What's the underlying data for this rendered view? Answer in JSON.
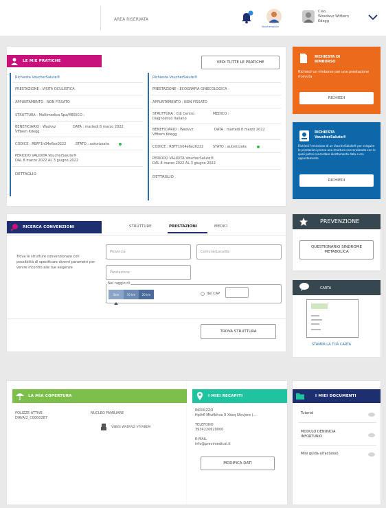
{
  "header": {
    "area_label": "AREA RISERVATA",
    "avatar_caption": "Vouchersalute",
    "user_greeting": "Ciao,",
    "user_name_line1": "Wzadwvz Wtfbem",
    "user_name_line2": "Kdegg"
  },
  "pratiche": {
    "tag": "LE MIE PRATICHE",
    "view_all": "VEDI TUTTE LE PRATICHE",
    "left": {
      "title": "Richiesta VoucherSalute®",
      "prestazione": "PRESTAZIONE : VISITA OCULISTICA",
      "appuntamento": "APPUNTAMENTO : NON FISSATO",
      "struttura": "STRUTTURA : Multimedica Spa/MEDICO :",
      "beneficiario": "BENEFICIARIO : Wadvvz",
      "beneficiario2": "Vffbem Kdegg",
      "data": "DATA : martedì 8 marzo 2022",
      "codice": "CODICE : RBFF1h04e6ez0222",
      "stato": "STATO : autorizzata",
      "periodo1": "PERIODO VALIDITA VoucherSalute®",
      "periodo2": "DAL 8 marzo 2022 AL 3 giugno 2022",
      "dettaglio": "DETTAGLIO"
    },
    "right": {
      "title": "Richiesta VoucherSalute®",
      "prestazione": "PRESTAZIONE : ECOGRAFIA GINECOLOGICA",
      "appuntamento": "APPUNTAMENTO : NON FISSATO",
      "struttura1": "STRUTTURA : Cdi Centro",
      "struttura2": "Diagnostico Italiano",
      "medico": "MEDICO :",
      "beneficiario": "BENEFICIARIO : Wadvvz",
      "beneficiario2": "Vffbem Kdegg",
      "data": "DATA : martedì 8 marzo 2022",
      "codice": "CODICE : RBFF1h04e6ez0222",
      "stato": "STATO : autorizzata",
      "periodo1": "PERIODO VALIDITA VoucherSalute®",
      "periodo2": "DAL 8 marzo 2022 AL 3 giugno 2022",
      "dettaglio": "DETTAGLIO"
    }
  },
  "rimborso": {
    "title1": "RICHIESTA DI",
    "title2": "RIMBORSO",
    "desc": "Richiedi un rimborso per una prestazione ricevuta",
    "button": "RICHIEDI"
  },
  "voucher": {
    "title1": "RICHIESTA",
    "title2": "VoucherSalute®",
    "desc": "Richiedi l'emissione di un VoucherSalute® per eseguire le prestazioni presso una struttura convenzionata con le quali potrai concordare direttamente data e ora appuntamento.",
    "button": "RICHIEDI"
  },
  "ricerca": {
    "tag": "RICERCA CONVENZIONI",
    "tabs": [
      "STRUTTURE",
      "PRESTAZIONI",
      "MEDICI"
    ],
    "desc": "Trova le strutture convenzionate con possibilità di specificare diversi parametri per venire incontro alle tue esigenze",
    "provincia": "Provincia",
    "comune": "Comune/Località",
    "prestazione": "Prestazione",
    "raggio_label": "Nel raggio di",
    "raggio_options": [
      "5km",
      "10 km",
      "20 km"
    ],
    "cap_label": "del CAP",
    "trova": "TROVA STRUTTURA"
  },
  "prevenzione": {
    "title": "PREVENZIONE",
    "questionario": "QUESTIONARIO SINDROME METABOLICA"
  },
  "carta": {
    "title": "CARTA",
    "stampa": "STAMPA LA TUA CARTA"
  },
  "copertura": {
    "tag": "LA MIA COPERTURA",
    "polizze_label": "POLIZZE ATTIVE",
    "polizze_value": "DIR/A/2_C0000287",
    "nucleo_label": "NUCLEO FAMILIARE",
    "nucleo_member": "VSBGI WADVVZ VFFABEM"
  },
  "recapiti": {
    "tag": "I MIEI RECAPITI",
    "indirizzo_label": "INDIRIZZO",
    "indirizzo_value": "Hpihfl Mhzfbhva 9 Xkeq Sfxvjere (...",
    "telefono_label": "TELEFONO",
    "telefono_value": "3934220620000",
    "email_label": "E-MAIL",
    "email_value": "info@previmedical.it",
    "modifica": "MODIFICA DATI"
  },
  "documenti": {
    "tag": "I MIEI DOCUMENTI",
    "items": [
      "Tutorial",
      "MODULO DENUNCIA INFORTUNIO",
      "Mini guida all'accesso"
    ]
  },
  "colors": {
    "magenta": "#c8117a",
    "orange": "#ec6a1b",
    "blue": "#0d67a8",
    "navy": "#1e2f6f",
    "green": "#7cc04b",
    "teal": "#1fc3a0",
    "dark": "#37474f"
  }
}
